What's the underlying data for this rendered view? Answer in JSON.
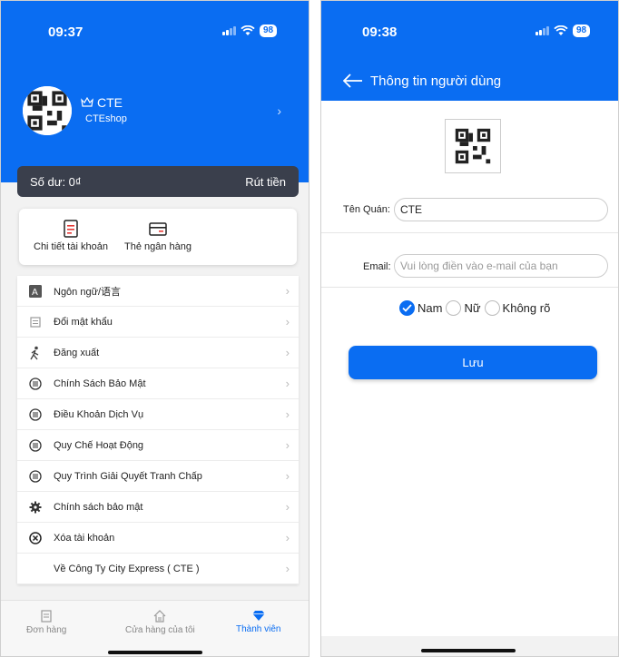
{
  "left": {
    "status": {
      "time": "09:37",
      "battery": "98"
    },
    "profile": {
      "name": "CTE",
      "shop": "CTEshop"
    },
    "balance": {
      "label": "Số dư: 0₫",
      "withdraw": "Rút tiền"
    },
    "quick": [
      {
        "label": "Chi tiết tài khoản",
        "icon": "account-detail-icon"
      },
      {
        "label": "Thẻ ngân hàng",
        "icon": "bank-card-icon"
      }
    ],
    "menu": [
      {
        "label": "Ngôn ngữ/语言",
        "icon": "language-icon"
      },
      {
        "label": "Đổi mật khẩu",
        "icon": "password-icon"
      },
      {
        "label": "Đăng xuất",
        "icon": "logout-walk-icon"
      },
      {
        "label": "Chính Sách Bảo Mật",
        "icon": "list-circle-icon"
      },
      {
        "label": "Điều Khoản Dịch Vụ",
        "icon": "list-circle-icon"
      },
      {
        "label": "Quy Chế Hoạt Động",
        "icon": "list-circle-icon"
      },
      {
        "label": "Quy Trình Giải Quyết Tranh Chấp",
        "icon": "list-circle-icon"
      },
      {
        "label": "Chính sách bảo mật",
        "icon": "gear-icon"
      },
      {
        "label": "Xóa tài khoản",
        "icon": "close-circle-icon"
      },
      {
        "label": "Về Công Ty City Express ( CTE )",
        "icon": ""
      }
    ],
    "tabs": [
      {
        "label": "Đơn hàng",
        "icon": "orders-icon"
      },
      {
        "label": "Cửa hàng của tôi",
        "icon": "store-icon"
      },
      {
        "label": "Thành viên",
        "icon": "member-diamond-icon",
        "active": true
      }
    ]
  },
  "right": {
    "status": {
      "time": "09:38",
      "battery": "98"
    },
    "title": "Thông tin người dùng",
    "shop_label": "Tên Quán:",
    "shop_value": "CTE",
    "email_label": "Email:",
    "email_placeholder": "Vui lòng điền vào e-mail của bạn",
    "gender": [
      {
        "label": "Nam",
        "selected": true
      },
      {
        "label": "Nữ",
        "selected": false
      },
      {
        "label": "Không rõ",
        "selected": false
      }
    ],
    "save": "Lưu"
  },
  "colors": {
    "brand": "#0a6df2",
    "balance_bg": "#3a3f4c"
  }
}
